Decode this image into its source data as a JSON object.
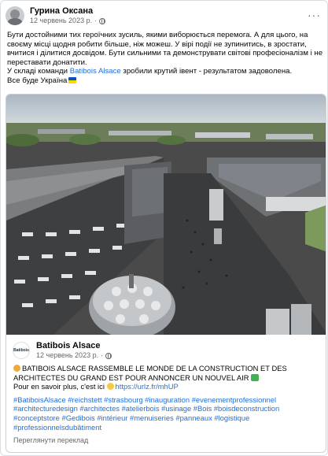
{
  "post": {
    "author": "Гурина Оксана",
    "date": "12 червень 2023 р.",
    "separator": "·",
    "more_label": "···",
    "paragraph1": "Бути достойними тих героїчних зусиль, якими виборюється перемога. А для цього, на своєму місці щодня робити більше, ніж можеш. У вірі події не зупинитись, в зростати, вчитися і ділитися досвідом. Бути сильними та демонструвати світові професіоналізм і не переставати донатити.",
    "para2_before": "У складі команди ",
    "para2_mention": "Batibois Alsace",
    "para2_after": "  зробили крутий івент - результатом задоволена.",
    "paragraph3": "Все буде Україна",
    "flag_icon": "ukraine-flag-icon"
  },
  "shared": {
    "page_name": "Batibois Alsace",
    "logo_text": "Batibois",
    "date": "12 червень 2023 р.",
    "separator": "·",
    "headline": "BATIBOIS ALSACE RASSEMBLE LE MONDE DE LA CONSTRUCTION ET DES ARCHITECTES DU GRAND EST POUR ANNONCER UN NOUVEL AIR",
    "link_intro": "Pour en savoir plus, c'est ici ",
    "link": "https://urlz.fr/mhUP",
    "hashtags": "#BatiboisAlsace #reichstett #strasbourg #inauguration #evenementprofessionnel #architecturedesign #architectes #atelierbois #usinage #Bois #boisdeconstruction #conceptstore #Gedibois #intérieur #menuiseries #panneaux #logistique #professionnelsdubâtiment",
    "translate_label": "Переглянути переклад"
  },
  "colors": {
    "link": "#216fdb",
    "secondary_text": "#65676b",
    "border": "#ced0d4"
  }
}
